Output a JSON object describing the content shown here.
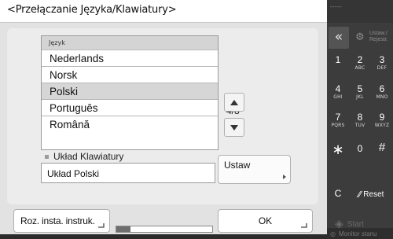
{
  "header": {
    "title": "<Przełączanie Języka/Klawiatury>"
  },
  "language_list": {
    "header_label": "Język",
    "items": [
      "Nederlands",
      "Norsk",
      "Polski",
      "Português",
      "Română"
    ],
    "selected": "Polski",
    "page_indicator": "4/8"
  },
  "keyboard": {
    "label": "Układ Klawiatury",
    "value": "Układ Polski",
    "set_label": "Ustaw"
  },
  "footer": {
    "instructions_label": "Roz. insta. instruk.",
    "progress_fraction": 0.15,
    "ok_label": "OK"
  },
  "keypad": {
    "top_dashes": "-----",
    "back_symbol": "«",
    "register_label": "Ustaw./ Rejestr.",
    "keys": [
      {
        "digit": "1",
        "letters": ""
      },
      {
        "digit": "2",
        "letters": "ABC"
      },
      {
        "digit": "3",
        "letters": "DEF"
      },
      {
        "digit": "4",
        "letters": "GHI"
      },
      {
        "digit": "5",
        "letters": "JKL"
      },
      {
        "digit": "6",
        "letters": "MNO"
      },
      {
        "digit": "7",
        "letters": "PQRS"
      },
      {
        "digit": "8",
        "letters": "TUV"
      },
      {
        "digit": "9",
        "letters": "WXYZ"
      }
    ],
    "star": "∗",
    "zero": "0",
    "hash": "#",
    "clear": "C",
    "reset_label": "Reset",
    "start_label": "Start",
    "monitor_label": "Monitor stanu"
  },
  "colors": {
    "screen_bg": "#e2e2e2",
    "panel_bg": "#ececec",
    "selected_row": "#d6d6d6",
    "keypad_bg": "#3c3c3c"
  }
}
